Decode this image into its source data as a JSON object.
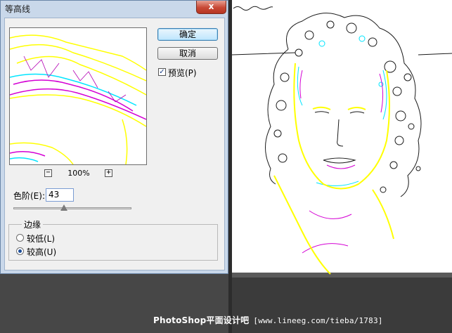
{
  "dialog": {
    "title": "等高线",
    "close_label": "x",
    "ok_label": "确定",
    "cancel_label": "取消",
    "preview_checkbox": {
      "label": "预览(P)",
      "checked": true
    },
    "zoom": {
      "minus": "−",
      "plus": "+",
      "level": "100%"
    },
    "level": {
      "label": "色阶(E):",
      "value": "43",
      "slider_fraction": 0.43
    },
    "edge": {
      "group_title": "边缘",
      "options": [
        {
          "label": "较低(L)",
          "selected": false
        },
        {
          "label": "较高(U)",
          "selected": true
        }
      ]
    }
  },
  "watermark": {
    "brand": "PhotoShop平面设计吧",
    "url": "[www.lineeg.com/tieba/1783]"
  },
  "colors": {
    "dialog_frame": "#c9d8ea",
    "dialog_body": "#f0f0f0",
    "close_button": "#c74835",
    "canvas": "#ffffff",
    "workspace": "#474747",
    "contour_yellow": "#ffff00",
    "contour_cyan": "#00e5ff",
    "contour_magenta": "#d400d4",
    "contour_dark": "#1a1a1a"
  },
  "icons": [
    "close-icon",
    "zoom-out-icon",
    "zoom-in-icon",
    "checkmark-icon",
    "radio-icon"
  ]
}
